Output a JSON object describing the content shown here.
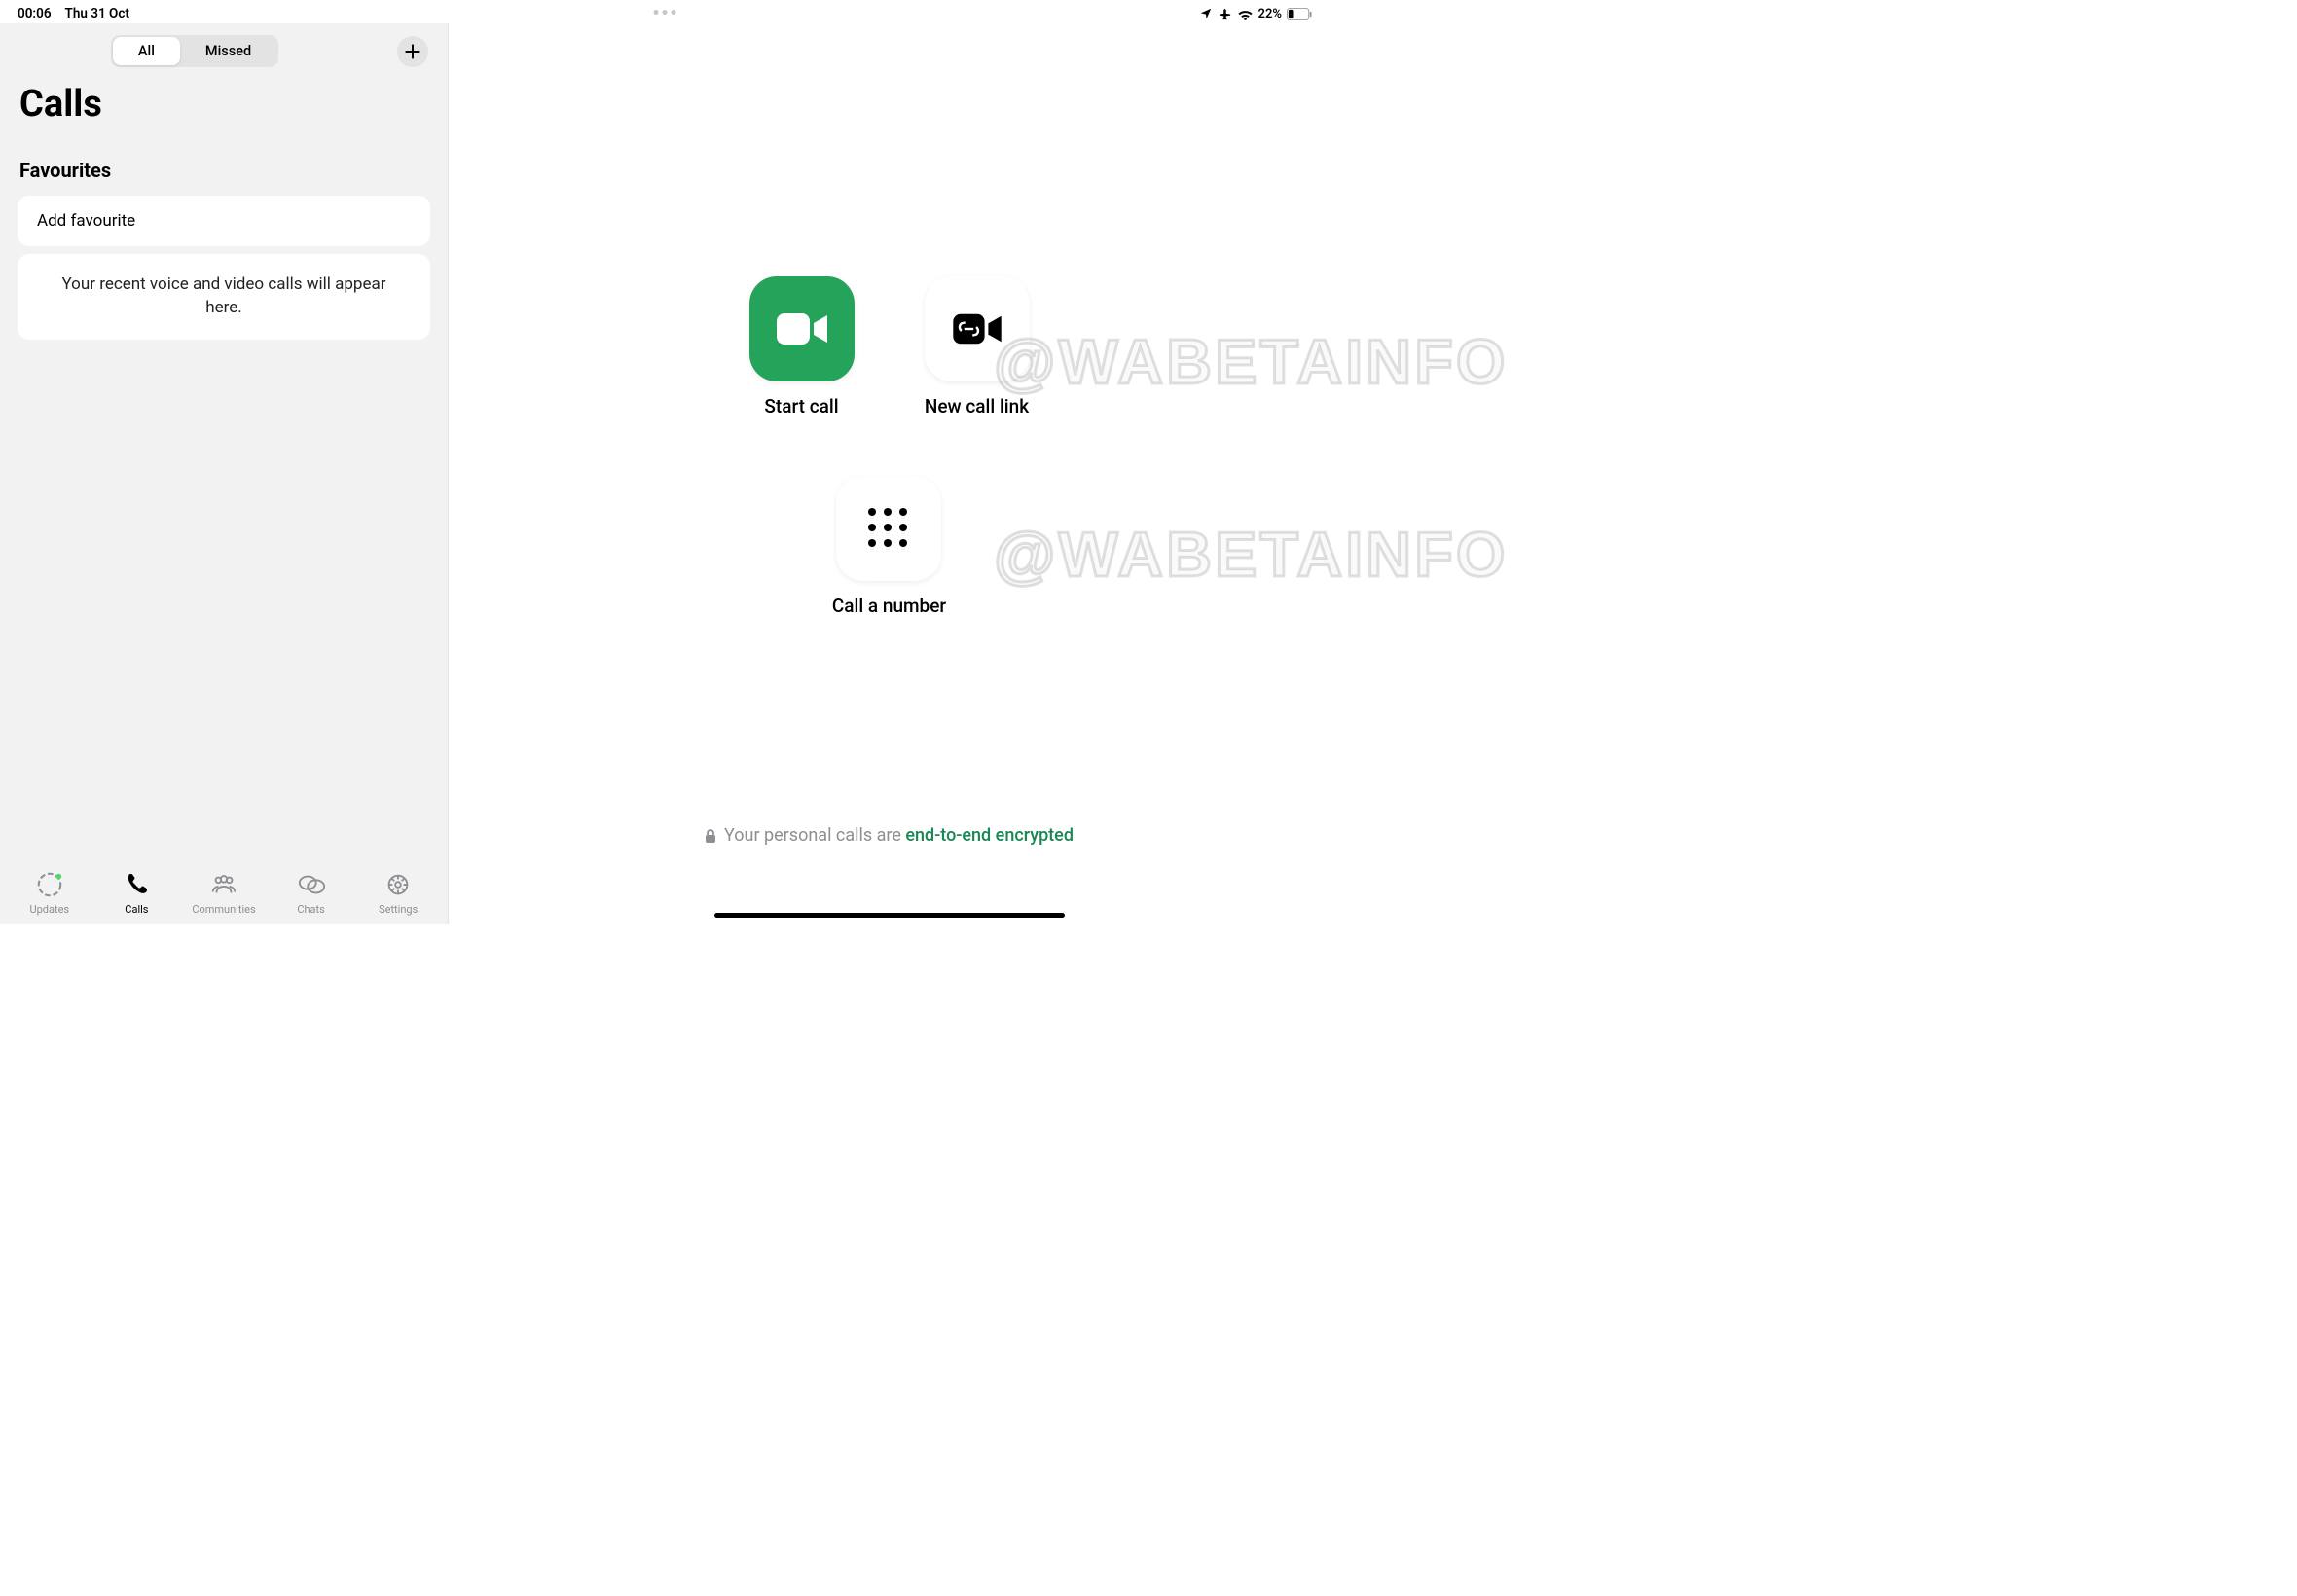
{
  "status": {
    "time": "00:06",
    "date": "Thu 31 Oct",
    "battery_pct": "22%"
  },
  "sidebar": {
    "seg_all": "All",
    "seg_missed": "Missed",
    "title": "Calls",
    "section_favourites": "Favourites",
    "add_favourite": "Add favourite",
    "empty_msg": "Your recent voice and video calls will appear here."
  },
  "tabs": {
    "updates": "Updates",
    "calls": "Calls",
    "communities": "Communities",
    "chats": "Chats",
    "settings": "Settings"
  },
  "actions": {
    "start_call": "Start call",
    "new_call_link": "New call link",
    "call_number": "Call a number"
  },
  "footer": {
    "prefix": "Your personal calls are ",
    "encrypted": "end-to-end encrypted"
  },
  "watermark": "@WABETAINFO"
}
